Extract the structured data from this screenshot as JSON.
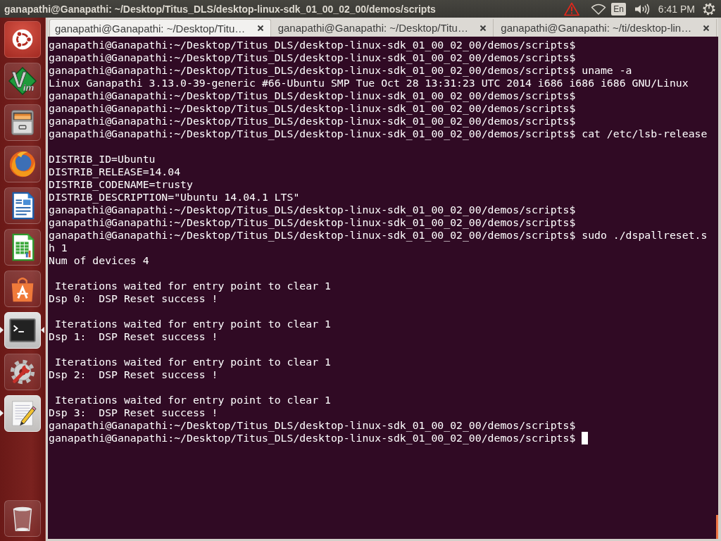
{
  "top_panel": {
    "title": "ganapathi@Ganapathi: ~/Desktop/Titus_DLS/desktop-linux-sdk_01_00_02_00/demos/scripts",
    "keyboard_layout": "En",
    "time": "6:41 PM"
  },
  "launcher": [
    {
      "kind": "dash",
      "running": false,
      "focused": false
    },
    {
      "kind": "vim",
      "running": false,
      "focused": false,
      "letters": [
        "V",
        "im"
      ]
    },
    {
      "kind": "files",
      "running": false,
      "focused": false
    },
    {
      "kind": "browser",
      "running": false,
      "focused": false
    },
    {
      "kind": "writer",
      "running": false,
      "focused": false
    },
    {
      "kind": "calc",
      "running": false,
      "focused": false
    },
    {
      "kind": "software",
      "running": false,
      "focused": false
    },
    {
      "kind": "terminal",
      "running": true,
      "focused": true
    },
    {
      "kind": "settings",
      "running": false,
      "focused": false
    },
    {
      "kind": "editor",
      "running": true,
      "focused": false
    }
  ],
  "window": {
    "tabs": [
      {
        "title": "ganapathi@Ganapathi: ~/Desktop/Titu…",
        "selected": true
      },
      {
        "title": "ganapathi@Ganapathi: ~/Desktop/Titu…",
        "selected": false
      },
      {
        "title": "ganapathi@Ganapathi: ~/ti/desktop-lin…",
        "selected": false
      }
    ],
    "terminal": {
      "cursor": true,
      "lines": [
        {
          "kind": "text",
          "text": "ganapathi@Ganapathi:~/Desktop/Titus_DLS/desktop-linux-sdk_01_00_02_00/demos/scripts$"
        },
        {
          "kind": "text",
          "text": "ganapathi@Ganapathi:~/Desktop/Titus_DLS/desktop-linux-sdk_01_00_02_00/demos/scripts$"
        },
        {
          "kind": "text",
          "text": "ganapathi@Ganapathi:~/Desktop/Titus_DLS/desktop-linux-sdk_01_00_02_00/demos/scripts$ uname -a"
        },
        {
          "kind": "text",
          "text": "Linux Ganapathi 3.13.0-39-generic #66-Ubuntu SMP Tue Oct 28 13:31:23 UTC 2014 i686 i686 i686 GNU/Linux"
        },
        {
          "kind": "text",
          "text": "ganapathi@Ganapathi:~/Desktop/Titus_DLS/desktop-linux-sdk_01_00_02_00/demos/scripts$"
        },
        {
          "kind": "text",
          "text": "ganapathi@Ganapathi:~/Desktop/Titus_DLS/desktop-linux-sdk_01_00_02_00/demos/scripts$"
        },
        {
          "kind": "text",
          "text": "ganapathi@Ganapathi:~/Desktop/Titus_DLS/desktop-linux-sdk_01_00_02_00/demos/scripts$"
        },
        {
          "kind": "text",
          "text": "ganapathi@Ganapathi:~/Desktop/Titus_DLS/desktop-linux-sdk_01_00_02_00/demos/scripts$ cat /etc/lsb-release"
        },
        {
          "kind": "blank"
        },
        {
          "kind": "text",
          "text": "DISTRIB_ID=Ubuntu"
        },
        {
          "kind": "text",
          "text": "DISTRIB_RELEASE=14.04"
        },
        {
          "kind": "text",
          "text": "DISTRIB_CODENAME=trusty"
        },
        {
          "kind": "text",
          "text": "DISTRIB_DESCRIPTION=\"Ubuntu 14.04.1 LTS\""
        },
        {
          "kind": "text",
          "text": "ganapathi@Ganapathi:~/Desktop/Titus_DLS/desktop-linux-sdk_01_00_02_00/demos/scripts$"
        },
        {
          "kind": "text",
          "text": "ganapathi@Ganapathi:~/Desktop/Titus_DLS/desktop-linux-sdk_01_00_02_00/demos/scripts$"
        },
        {
          "kind": "text",
          "text": "ganapathi@Ganapathi:~/Desktop/Titus_DLS/desktop-linux-sdk_01_00_02_00/demos/scripts$ sudo ./dspallreset.s"
        },
        {
          "kind": "text",
          "text": "h 1"
        },
        {
          "kind": "text",
          "text": "Num of devices 4"
        },
        {
          "kind": "blank"
        },
        {
          "kind": "text",
          "text": " Iterations waited for entry point to clear 1"
        },
        {
          "kind": "text",
          "text": "Dsp 0:  DSP Reset success !"
        },
        {
          "kind": "blank"
        },
        {
          "kind": "text",
          "text": " Iterations waited for entry point to clear 1"
        },
        {
          "kind": "text",
          "text": "Dsp 1:  DSP Reset success !"
        },
        {
          "kind": "blank"
        },
        {
          "kind": "text",
          "text": " Iterations waited for entry point to clear 1"
        },
        {
          "kind": "text",
          "text": "Dsp 2:  DSP Reset success !"
        },
        {
          "kind": "blank"
        },
        {
          "kind": "text",
          "text": " Iterations waited for entry point to clear 1"
        },
        {
          "kind": "text",
          "text": "Dsp 3:  DSP Reset success !"
        },
        {
          "kind": "text",
          "text": "ganapathi@Ganapathi:~/Desktop/Titus_DLS/desktop-linux-sdk_01_00_02_00/demos/scripts$"
        },
        {
          "kind": "text",
          "text": "ganapathi@Ganapathi:~/Desktop/Titus_DLS/desktop-linux-sdk_01_00_02_00/demos/scripts$"
        }
      ]
    }
  }
}
